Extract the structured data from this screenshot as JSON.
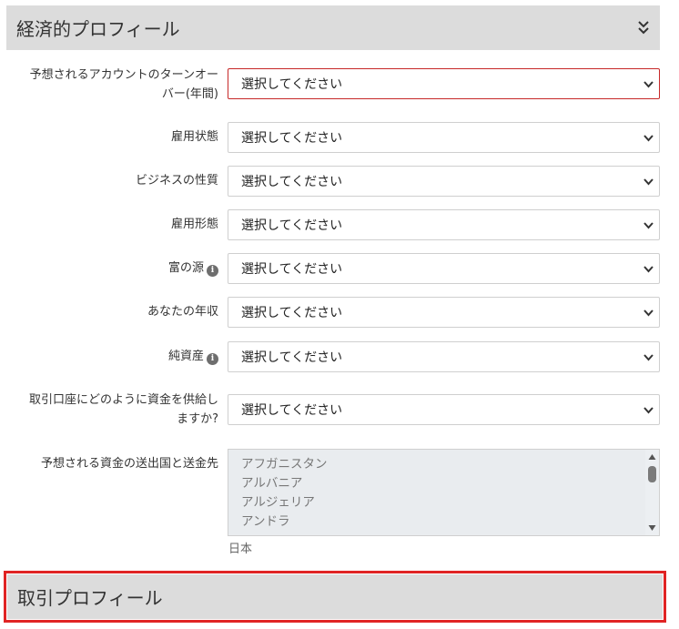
{
  "economic_profile": {
    "title": "経済的プロフィール",
    "toggle_icon": "double-chevron-down-icon"
  },
  "fields": [
    {
      "label_lines": [
        "予想されるアカウントのターンオー",
        "バー(年間)"
      ],
      "value": "選択してください",
      "error": true
    },
    {
      "label_lines": [
        "雇用状態"
      ],
      "value": "選択してください",
      "error": false
    },
    {
      "label_lines": [
        "ビジネスの性質"
      ],
      "value": "選択してください",
      "error": false
    },
    {
      "label_lines": [
        "雇用形態"
      ],
      "value": "選択してください",
      "error": false
    },
    {
      "label_lines": [
        "富の源"
      ],
      "value": "選択してください",
      "error": false,
      "info_icon": true
    },
    {
      "label_lines": [
        "あなたの年収"
      ],
      "value": "選択してください",
      "error": false
    },
    {
      "label_lines": [
        "純資産"
      ],
      "value": "選択してください",
      "error": false,
      "info_icon": true
    },
    {
      "label_lines": [
        "取引口座にどのように資金を供給し",
        "ますか?"
      ],
      "value": "選択してください",
      "error": false
    }
  ],
  "countries_field": {
    "label": "予想される資金の送出国と送金先",
    "options": [
      "アフガニスタン",
      "アルバニア",
      "アルジェリア",
      "アンドラ"
    ],
    "selected": "日本"
  },
  "trading_profile": {
    "title": "取引プロフィール"
  },
  "colors": {
    "header_bg": "#dcdcdc",
    "error_border": "#c62828",
    "highlight_border": "#e02424"
  }
}
